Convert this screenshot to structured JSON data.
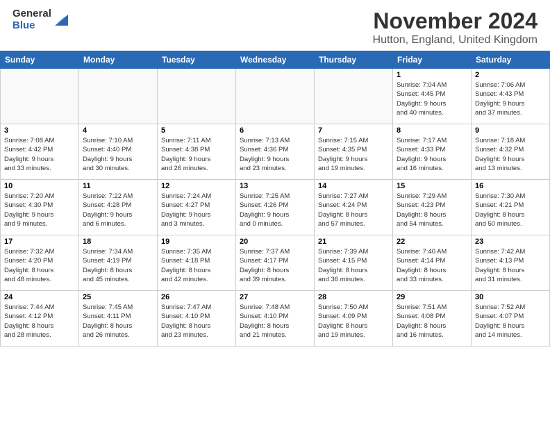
{
  "header": {
    "logo_general": "General",
    "logo_blue": "Blue",
    "main_title": "November 2024",
    "subtitle": "Hutton, England, United Kingdom"
  },
  "weekdays": [
    "Sunday",
    "Monday",
    "Tuesday",
    "Wednesday",
    "Thursday",
    "Friday",
    "Saturday"
  ],
  "weeks": [
    [
      {
        "day": "",
        "info": ""
      },
      {
        "day": "",
        "info": ""
      },
      {
        "day": "",
        "info": ""
      },
      {
        "day": "",
        "info": ""
      },
      {
        "day": "",
        "info": ""
      },
      {
        "day": "1",
        "info": "Sunrise: 7:04 AM\nSunset: 4:45 PM\nDaylight: 9 hours\nand 40 minutes."
      },
      {
        "day": "2",
        "info": "Sunrise: 7:06 AM\nSunset: 4:43 PM\nDaylight: 9 hours\nand 37 minutes."
      }
    ],
    [
      {
        "day": "3",
        "info": "Sunrise: 7:08 AM\nSunset: 4:42 PM\nDaylight: 9 hours\nand 33 minutes."
      },
      {
        "day": "4",
        "info": "Sunrise: 7:10 AM\nSunset: 4:40 PM\nDaylight: 9 hours\nand 30 minutes."
      },
      {
        "day": "5",
        "info": "Sunrise: 7:11 AM\nSunset: 4:38 PM\nDaylight: 9 hours\nand 26 minutes."
      },
      {
        "day": "6",
        "info": "Sunrise: 7:13 AM\nSunset: 4:36 PM\nDaylight: 9 hours\nand 23 minutes."
      },
      {
        "day": "7",
        "info": "Sunrise: 7:15 AM\nSunset: 4:35 PM\nDaylight: 9 hours\nand 19 minutes."
      },
      {
        "day": "8",
        "info": "Sunrise: 7:17 AM\nSunset: 4:33 PM\nDaylight: 9 hours\nand 16 minutes."
      },
      {
        "day": "9",
        "info": "Sunrise: 7:18 AM\nSunset: 4:32 PM\nDaylight: 9 hours\nand 13 minutes."
      }
    ],
    [
      {
        "day": "10",
        "info": "Sunrise: 7:20 AM\nSunset: 4:30 PM\nDaylight: 9 hours\nand 9 minutes."
      },
      {
        "day": "11",
        "info": "Sunrise: 7:22 AM\nSunset: 4:28 PM\nDaylight: 9 hours\nand 6 minutes."
      },
      {
        "day": "12",
        "info": "Sunrise: 7:24 AM\nSunset: 4:27 PM\nDaylight: 9 hours\nand 3 minutes."
      },
      {
        "day": "13",
        "info": "Sunrise: 7:25 AM\nSunset: 4:26 PM\nDaylight: 9 hours\nand 0 minutes."
      },
      {
        "day": "14",
        "info": "Sunrise: 7:27 AM\nSunset: 4:24 PM\nDaylight: 8 hours\nand 57 minutes."
      },
      {
        "day": "15",
        "info": "Sunrise: 7:29 AM\nSunset: 4:23 PM\nDaylight: 8 hours\nand 54 minutes."
      },
      {
        "day": "16",
        "info": "Sunrise: 7:30 AM\nSunset: 4:21 PM\nDaylight: 8 hours\nand 50 minutes."
      }
    ],
    [
      {
        "day": "17",
        "info": "Sunrise: 7:32 AM\nSunset: 4:20 PM\nDaylight: 8 hours\nand 48 minutes."
      },
      {
        "day": "18",
        "info": "Sunrise: 7:34 AM\nSunset: 4:19 PM\nDaylight: 8 hours\nand 45 minutes."
      },
      {
        "day": "19",
        "info": "Sunrise: 7:35 AM\nSunset: 4:18 PM\nDaylight: 8 hours\nand 42 minutes."
      },
      {
        "day": "20",
        "info": "Sunrise: 7:37 AM\nSunset: 4:17 PM\nDaylight: 8 hours\nand 39 minutes."
      },
      {
        "day": "21",
        "info": "Sunrise: 7:39 AM\nSunset: 4:15 PM\nDaylight: 8 hours\nand 36 minutes."
      },
      {
        "day": "22",
        "info": "Sunrise: 7:40 AM\nSunset: 4:14 PM\nDaylight: 8 hours\nand 33 minutes."
      },
      {
        "day": "23",
        "info": "Sunrise: 7:42 AM\nSunset: 4:13 PM\nDaylight: 8 hours\nand 31 minutes."
      }
    ],
    [
      {
        "day": "24",
        "info": "Sunrise: 7:44 AM\nSunset: 4:12 PM\nDaylight: 8 hours\nand 28 minutes."
      },
      {
        "day": "25",
        "info": "Sunrise: 7:45 AM\nSunset: 4:11 PM\nDaylight: 8 hours\nand 26 minutes."
      },
      {
        "day": "26",
        "info": "Sunrise: 7:47 AM\nSunset: 4:10 PM\nDaylight: 8 hours\nand 23 minutes."
      },
      {
        "day": "27",
        "info": "Sunrise: 7:48 AM\nSunset: 4:10 PM\nDaylight: 8 hours\nand 21 minutes."
      },
      {
        "day": "28",
        "info": "Sunrise: 7:50 AM\nSunset: 4:09 PM\nDaylight: 8 hours\nand 19 minutes."
      },
      {
        "day": "29",
        "info": "Sunrise: 7:51 AM\nSunset: 4:08 PM\nDaylight: 8 hours\nand 16 minutes."
      },
      {
        "day": "30",
        "info": "Sunrise: 7:52 AM\nSunset: 4:07 PM\nDaylight: 8 hours\nand 14 minutes."
      }
    ]
  ]
}
